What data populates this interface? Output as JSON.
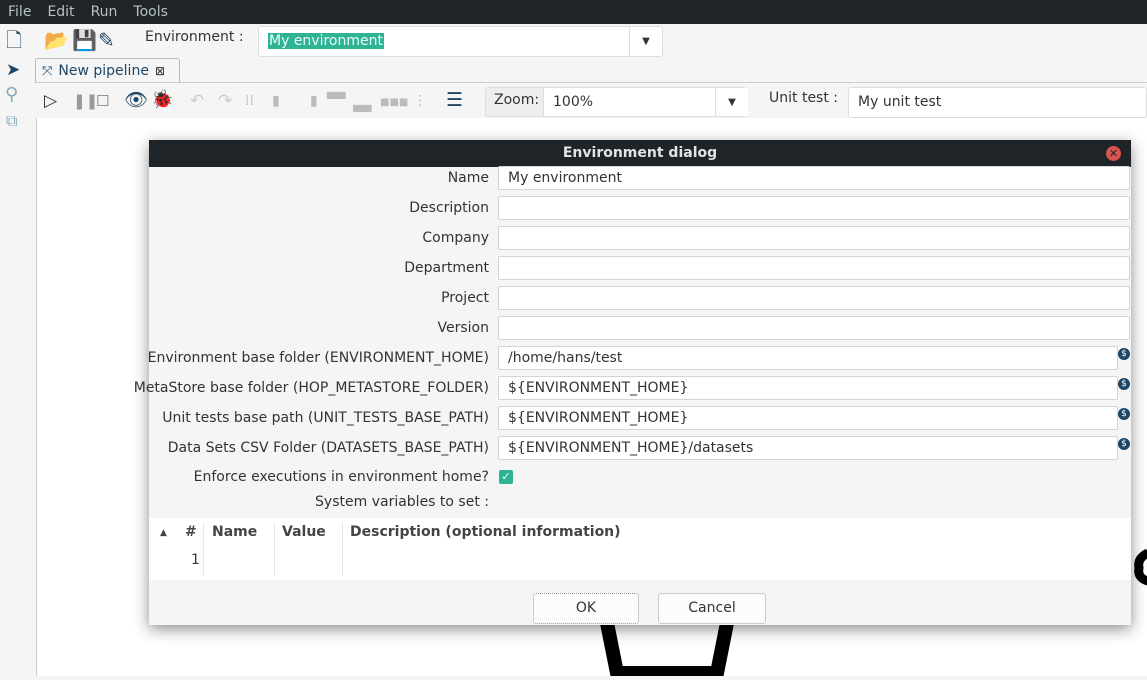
{
  "menu": [
    "File",
    "Edit",
    "Run",
    "Tools"
  ],
  "toolbar": {
    "environment_label": "Environment :",
    "environment_value": "My environment"
  },
  "tab": {
    "label": "New pipeline"
  },
  "pipeline_toolbar": {
    "zoom_label": "Zoom:",
    "zoom_value": "100%",
    "unit_test_label": "Unit test :",
    "unit_test_value": "My unit test"
  },
  "dialog": {
    "title": "Environment dialog",
    "fields": [
      {
        "label": "Name",
        "value": "My environment"
      },
      {
        "label": "Description",
        "value": ""
      },
      {
        "label": "Company",
        "value": ""
      },
      {
        "label": "Department",
        "value": ""
      },
      {
        "label": "Project",
        "value": ""
      },
      {
        "label": "Version",
        "value": ""
      },
      {
        "label": "Environment base folder (ENVIRONMENT_HOME)",
        "value": "/home/hans/test"
      },
      {
        "label": "MetaStore base folder (HOP_METASTORE_FOLDER)",
        "value": "${ENVIRONMENT_HOME}"
      },
      {
        "label": "Unit tests base path (UNIT_TESTS_BASE_PATH)",
        "value": "${ENVIRONMENT_HOME}"
      },
      {
        "label": "Data Sets CSV Folder (DATASETS_BASE_PATH)",
        "value": "${ENVIRONMENT_HOME}/datasets"
      }
    ],
    "enforce_label": "Enforce executions in environment home?",
    "enforce_checked": true,
    "sysvars_label": "System variables to set :",
    "table": {
      "columns": [
        "#",
        "Name",
        "Value",
        "Description (optional information)"
      ],
      "rows": [
        [
          "1",
          "",
          "",
          ""
        ]
      ]
    },
    "ok": "OK",
    "cancel": "Cancel"
  },
  "colors": {
    "accent": "#2eb394",
    "dark": "#1e2427",
    "icon": "#1d4666"
  }
}
